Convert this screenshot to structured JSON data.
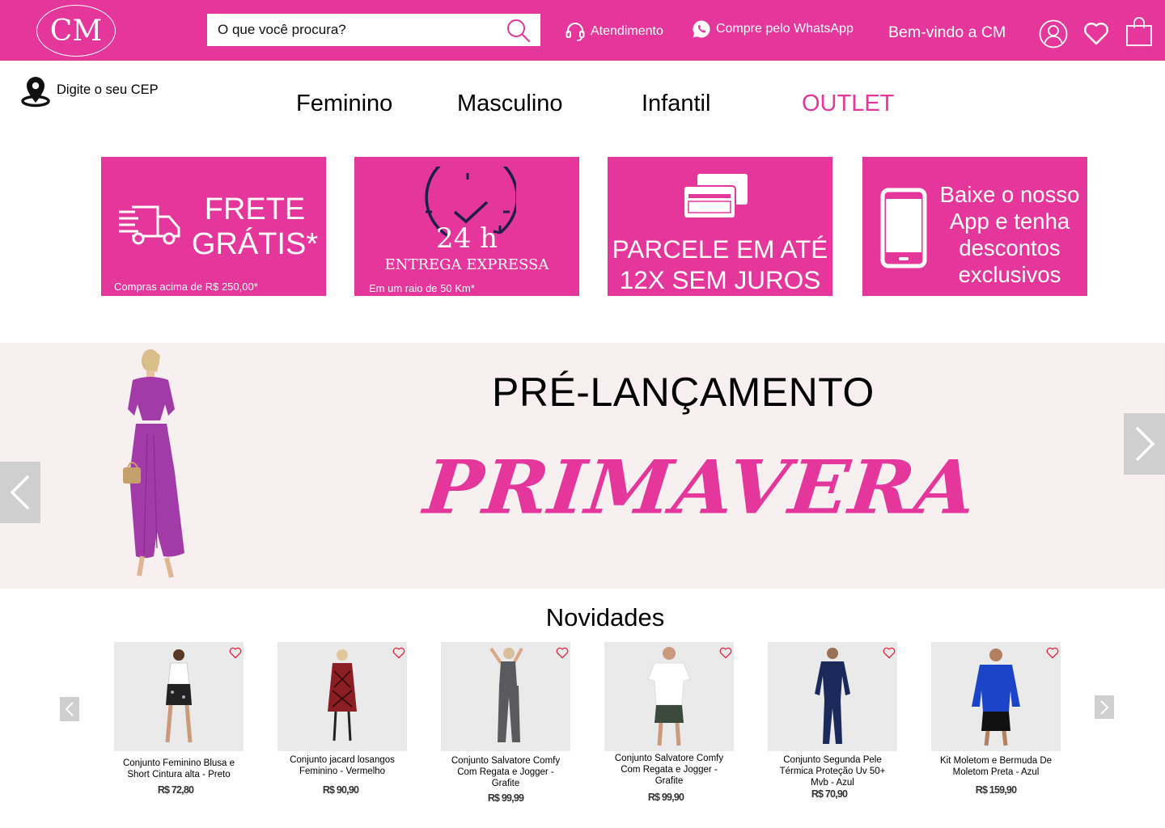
{
  "header": {
    "logo": "CM",
    "search_placeholder": "O que você procura?",
    "support_label": "Atendimento",
    "whatsapp_label": "Compre pelo WhatsApp",
    "welcome": "Bem-vindo a CM"
  },
  "cep": {
    "label": "Digite o seu CEP"
  },
  "nav": {
    "feminino": "Feminino",
    "masculino": "Masculino",
    "infantil": "Infantil",
    "outlet": "OUTLET"
  },
  "features": {
    "frete": {
      "title_line1": "FRETE",
      "title_line2": "GRÁTIS*",
      "note": "Compras acima de R$ 250,00*"
    },
    "entrega": {
      "hours": "24 h",
      "title": "ENTREGA EXPRESSA",
      "note": "Em um raio de 50 Km*"
    },
    "parcele": {
      "line1": "PARCELE EM ATÉ",
      "line2": "12X SEM JUROS"
    },
    "app": {
      "line1": "Baixe o nosso",
      "line2": "App e tenha",
      "line3": "descontos",
      "line4": "exclusivos"
    }
  },
  "banner": {
    "pre": "PRÉ-LANÇAMENTO",
    "title": "PRIMAVERA"
  },
  "novidades": {
    "title": "Novidades",
    "products": [
      {
        "name_l1": "Conjunto Feminino Blusa e",
        "name_l2": "Short Cintura alta - Preto",
        "name_l3": "",
        "price": "R$ 72,80"
      },
      {
        "name_l1": "Conjunto jacard losangos",
        "name_l2": "Feminino - Vermelho",
        "name_l3": "",
        "price": "R$ 90,90"
      },
      {
        "name_l1": "Conjunto Salvatore Comfy",
        "name_l2": "Com Regata e Jogger  -",
        "name_l3": "Grafite",
        "price": "R$ 99,99"
      },
      {
        "name_l1": "Conjunto Salvatore Comfy",
        "name_l2": "Com Regata e Jogger  -",
        "name_l3": "Grafite",
        "price": "R$ 99,90"
      },
      {
        "name_l1": "Conjunto Segunda Pele",
        "name_l2": "Térmica Proteção Uv 50+",
        "name_l3": "Mvb - Azul",
        "price": "R$ 70,90"
      },
      {
        "name_l1": "Kit Moletom e Bermuda De",
        "name_l2": "Moletom Preta - Azul",
        "name_l3": "",
        "price": "R$ 159,90"
      }
    ]
  },
  "colors": {
    "brand": "#e5369b",
    "banner_bg": "#f8eff0",
    "arrow_bg": "#cfcfcf"
  }
}
